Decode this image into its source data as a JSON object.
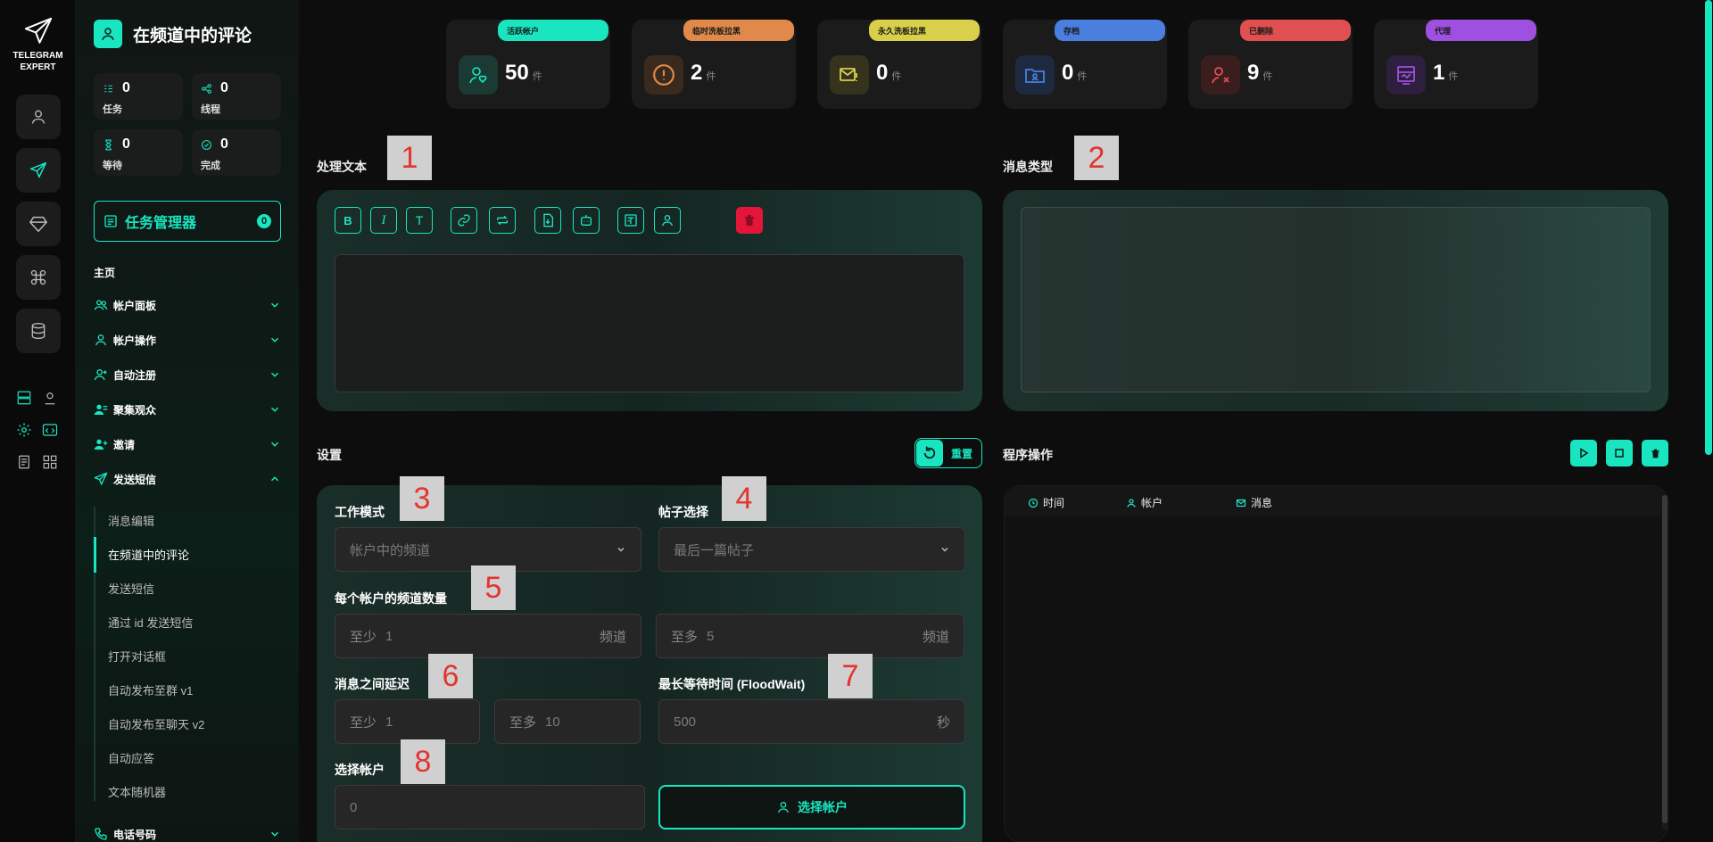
{
  "app": {
    "logo_line1": "TELEGRAM",
    "logo_line2": "EXPERT",
    "accent": "#19e6c1"
  },
  "sidebar": {
    "title": "在频道中的评论",
    "stats": [
      {
        "value": "0",
        "label": "任务"
      },
      {
        "value": "0",
        "label": "线程"
      },
      {
        "value": "0",
        "label": "等待"
      },
      {
        "value": "0",
        "label": "完成"
      }
    ],
    "task_manager": {
      "label": "任务管理器",
      "count": "0"
    },
    "home": "主页",
    "groups": [
      {
        "label": "帐户面板"
      },
      {
        "label": "帐户操作"
      },
      {
        "label": "自动注册"
      },
      {
        "label": "聚集观众"
      },
      {
        "label": "邀请"
      },
      {
        "label": "发送短信"
      }
    ],
    "sub_items": [
      "消息编辑",
      "在频道中的评论",
      "发送短信",
      "通过 id 发送短信",
      "打开对话框",
      "自动发布至群 v1",
      "自动发布至聊天 v2",
      "自动应答",
      "文本随机器"
    ],
    "last_group": "电话号码"
  },
  "cards": [
    {
      "badge": "活跃帐户",
      "value": "50",
      "unit": "件",
      "color": "#19e6c1"
    },
    {
      "badge": "临时洗板拉黑",
      "value": "2",
      "unit": "件",
      "color": "#e0894a"
    },
    {
      "badge": "永久洗板拉黑",
      "value": "0",
      "unit": "件",
      "color": "#d8d04a"
    },
    {
      "badge": "存档",
      "value": "0",
      "unit": "件",
      "color": "#4a7fe0"
    },
    {
      "badge": "已删除",
      "value": "9",
      "unit": "件",
      "color": "#e05050"
    },
    {
      "badge": "代理",
      "value": "1",
      "unit": "件",
      "color": "#a050e0"
    }
  ],
  "sections": {
    "process_text": "处理文本",
    "message_type": "消息类型",
    "settings": "设置",
    "reset": "重置",
    "program_ops": "程序操作"
  },
  "tags": [
    "1",
    "2",
    "3",
    "4",
    "5",
    "6",
    "7",
    "8"
  ],
  "form": {
    "work_mode": {
      "label": "工作模式",
      "value": "帐户中的频道"
    },
    "post_select": {
      "label": "帖子选择",
      "value": "最后一篇帖子"
    },
    "channels_per_account": {
      "label": "每个帐户的频道数量",
      "min_prefix": "至少",
      "min": "1",
      "max_prefix": "至多",
      "max": "5",
      "unit": "频道"
    },
    "delay": {
      "label": "消息之间延迟",
      "min_prefix": "至少",
      "min": "1",
      "max_prefix": "至多",
      "max": "10"
    },
    "flood_wait": {
      "label": "最长等待时间 (FloodWait)",
      "value": "500",
      "unit": "秒"
    },
    "accounts": {
      "label": "选择帐户",
      "value": "0",
      "button": "选择帐户"
    }
  },
  "log": {
    "columns": [
      "时间",
      "帐户",
      "消息"
    ]
  }
}
